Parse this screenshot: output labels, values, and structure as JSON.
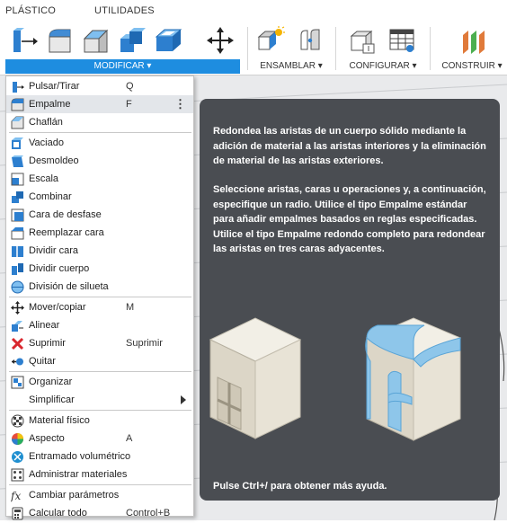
{
  "tabs": [
    {
      "label": "PLÁSTICO"
    },
    {
      "label": "UTILIDADES"
    }
  ],
  "groups": {
    "modify": "MODIFICAR ▾",
    "assemble": "ENSAMBLAR ▾",
    "configure": "CONFIGURAR ▾",
    "construct": "CONSTRUIR ▾"
  },
  "toolbar_icons": [
    "press-pull-icon",
    "fillet-icon",
    "chamfer-icon",
    "combine-icon",
    "shell-icon",
    "move-icon",
    "new-component-icon",
    "joint-icon",
    "configure-table-icon",
    "parameter-table-icon",
    "offset-plane-icon"
  ],
  "menu": {
    "items": [
      {
        "label": "Pulsar/Tirar",
        "shortcut": "Q",
        "icon": "press-pull-icon"
      },
      {
        "label": "Empalme",
        "shortcut": "F",
        "icon": "fillet-icon",
        "more": "⋮"
      },
      {
        "label": "Chaflán",
        "shortcut": "",
        "icon": "chamfer-icon"
      },
      {
        "label": "Vaciado",
        "shortcut": "",
        "icon": "shell-icon"
      },
      {
        "label": "Desmoldeo",
        "shortcut": "",
        "icon": "draft-icon"
      },
      {
        "label": "Escala",
        "shortcut": "",
        "icon": "scale-icon"
      },
      {
        "label": "Combinar",
        "shortcut": "",
        "icon": "combine-icon"
      },
      {
        "label": "Cara de desfase",
        "shortcut": "",
        "icon": "offset-face-icon"
      },
      {
        "label": "Reemplazar cara",
        "shortcut": "",
        "icon": "replace-face-icon"
      },
      {
        "label": "Dividir cara",
        "shortcut": "",
        "icon": "split-face-icon"
      },
      {
        "label": "Dividir cuerpo",
        "shortcut": "",
        "icon": "split-body-icon"
      },
      {
        "label": "División de silueta",
        "shortcut": "",
        "icon": "silhouette-split-icon"
      },
      {
        "label": "Mover/copiar",
        "shortcut": "M",
        "icon": "move-icon"
      },
      {
        "label": "Alinear",
        "shortcut": "",
        "icon": "align-icon"
      },
      {
        "label": "Suprimir",
        "shortcut": "Suprimir",
        "icon": "delete-icon"
      },
      {
        "label": "Quitar",
        "shortcut": "",
        "icon": "remove-icon"
      },
      {
        "label": "Organizar",
        "shortcut": "",
        "icon": "arrange-icon"
      },
      {
        "label": "Simplificar",
        "shortcut": "",
        "icon": "",
        "submenu": true
      },
      {
        "label": "Material físico",
        "shortcut": "",
        "icon": "physical-material-icon"
      },
      {
        "label": "Aspecto",
        "shortcut": "A",
        "icon": "appearance-icon"
      },
      {
        "label": "Entramado volumétrico",
        "shortcut": "",
        "icon": "volumetric-lattice-icon"
      },
      {
        "label": "Administrar materiales",
        "shortcut": "",
        "icon": "manage-materials-icon"
      },
      {
        "label": "Cambiar parámetros",
        "shortcut": "",
        "icon": "change-parameters-icon"
      },
      {
        "label": "Calcular todo",
        "shortcut": "Control+B",
        "icon": "compute-all-icon"
      }
    ]
  },
  "tooltip": {
    "paragraph1": "Redondea las aristas de un cuerpo sólido mediante la adición de material a las aristas interiores y la eliminación de material de las aristas exteriores.",
    "paragraph2": "Seleccione aristas, caras u operaciones y, a continuación, especifique un radio. Utilice el tipo Empalme estándar para añadir empalmes basados en reglas especificadas. Utilice el tipo Empalme redondo completo para redondear las aristas en tres caras adyacentes.",
    "footer": "Pulse Ctrl+/ para obtener más ayuda."
  },
  "colors": {
    "accent": "#1e8de0",
    "tooltip_bg": "#4a4d52",
    "fillet_blue": "#8ec6ea"
  }
}
